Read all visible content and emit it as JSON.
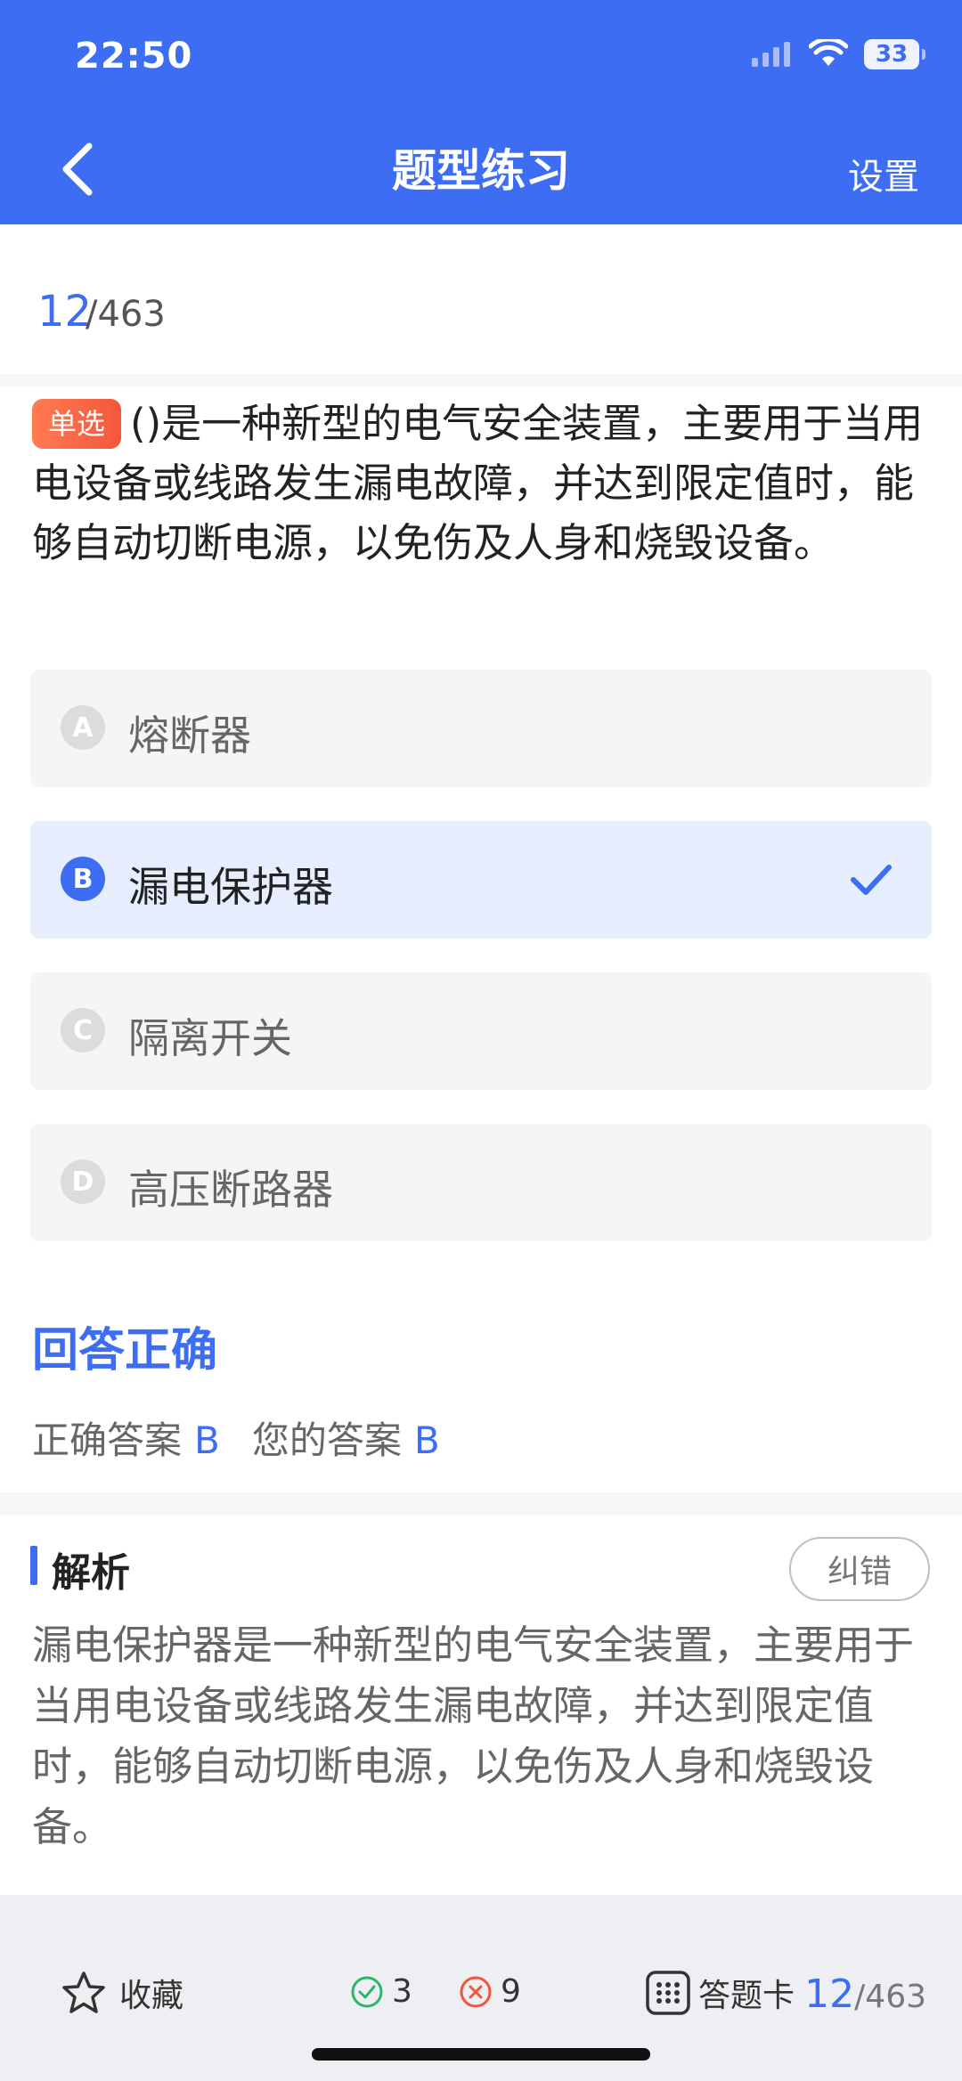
{
  "status_bar": {
    "time": "22:50",
    "battery": "33"
  },
  "header": {
    "title": "题型练习",
    "settings_label": "设置"
  },
  "progress": {
    "current": "12",
    "total": "/463"
  },
  "question": {
    "type_tag": "单选",
    "text": "()是一种新型的电气安全装置，主要用于当用电设备或线路发生漏电故障，并达到限定值时，能够自动切断电源，以免伤及人身和烧毁设备。"
  },
  "options": [
    {
      "letter": "A",
      "text": "熔断器"
    },
    {
      "letter": "B",
      "text": "漏电保护器"
    },
    {
      "letter": "C",
      "text": "隔离开关"
    },
    {
      "letter": "D",
      "text": "高压断路器"
    }
  ],
  "selected_option": "B",
  "result": {
    "title": "回答正确",
    "correct_label": "正确答案",
    "correct_value": "B",
    "yours_label": "您的答案",
    "yours_value": "B"
  },
  "analysis": {
    "title": "解析",
    "report_label": "纠错",
    "text": "漏电保护器是一种新型的电气安全装置，主要用于当用电设备或线路发生漏电故障，并达到限定值时，能够自动切断电源，以免伤及人身和烧毁设备。"
  },
  "bottom_bar": {
    "favorite_label": "收藏",
    "correct_count": "3",
    "wrong_count": "9",
    "answer_card_label": "答题卡",
    "progress_current": "12",
    "progress_total": "/463"
  },
  "colors": {
    "accent": "#3d6df2",
    "tag": "#f4573c",
    "correct": "#2fb56a",
    "wrong": "#f0553f"
  },
  "icons": [
    "back-icon",
    "signal-icon",
    "wifi-icon",
    "battery-icon",
    "check-icon",
    "star-icon",
    "correct-circle-icon",
    "wrong-circle-icon",
    "grid-icon"
  ]
}
